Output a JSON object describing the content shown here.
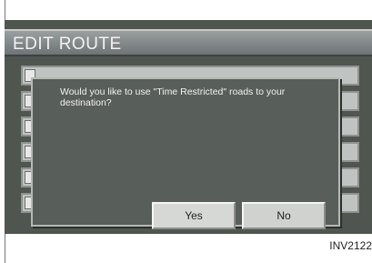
{
  "window": {
    "title": "EDIT ROUTE"
  },
  "dialog": {
    "message": "Would you like to use \"Time Restricted\" roads to your destination?",
    "yes_label": "Yes",
    "no_label": "No"
  },
  "caption": {
    "text": "INV2122"
  }
}
